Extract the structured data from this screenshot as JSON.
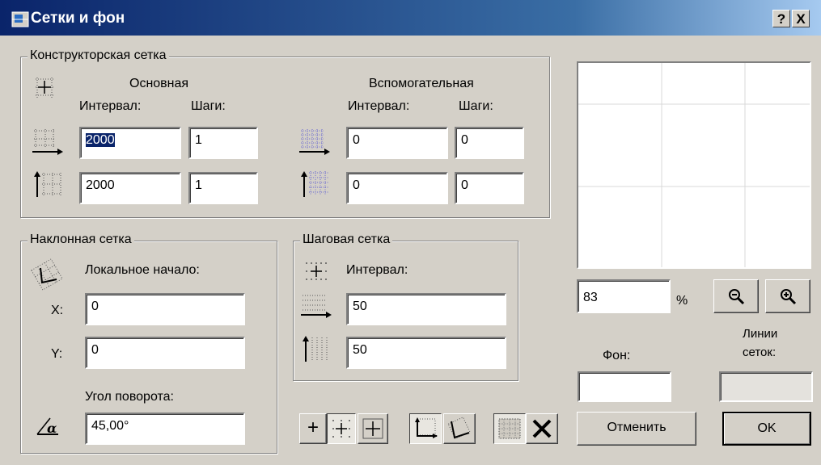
{
  "window": {
    "title": "Сетки и фон",
    "help_label": "?",
    "close_label": "X"
  },
  "construction_grid": {
    "title": "Конструкторская сетка",
    "main": {
      "title": "Основная",
      "interval_label": "Интервал:",
      "steps_label": "Шаги:",
      "x_interval": "2000",
      "x_steps": "1",
      "y_interval": "2000",
      "y_steps": "1"
    },
    "aux": {
      "title": "Вспомогательная",
      "interval_label": "Интервал:",
      "steps_label": "Шаги:",
      "x_interval": "0",
      "x_steps": "0",
      "y_interval": "0",
      "y_steps": "0"
    }
  },
  "rotated_grid": {
    "title": "Наклонная сетка",
    "origin_label": "Локальное начало:",
    "x_label": "X:",
    "x_value": "0",
    "y_label": "Y:",
    "y_value": "0",
    "angle_label": "Угол поворота:",
    "angle_value": "45,00°"
  },
  "snap_grid": {
    "title": "Шаговая сетка",
    "interval_label": "Интервал:",
    "x_value": "50",
    "y_value": "50"
  },
  "preview": {
    "zoom": "83",
    "zoom_unit": "%"
  },
  "colors": {
    "background_label": "Фон:",
    "grid_lines_label_1": "Линии",
    "grid_lines_label_2": "сеток:"
  },
  "buttons": {
    "cancel": "Отменить",
    "ok": "OK"
  },
  "icons": [
    "grid-origin-icon",
    "horizontal-spacing-icon",
    "vertical-spacing-icon",
    "rotated-grid-icon",
    "angle-icon",
    "zoom-out-icon",
    "zoom-in-icon",
    "plus-icon",
    "snap-grid-icon",
    "construction-grid-icon",
    "ortho-grid-icon",
    "rotated-grid-mode-icon",
    "fill-grid-icon",
    "x-icon"
  ]
}
